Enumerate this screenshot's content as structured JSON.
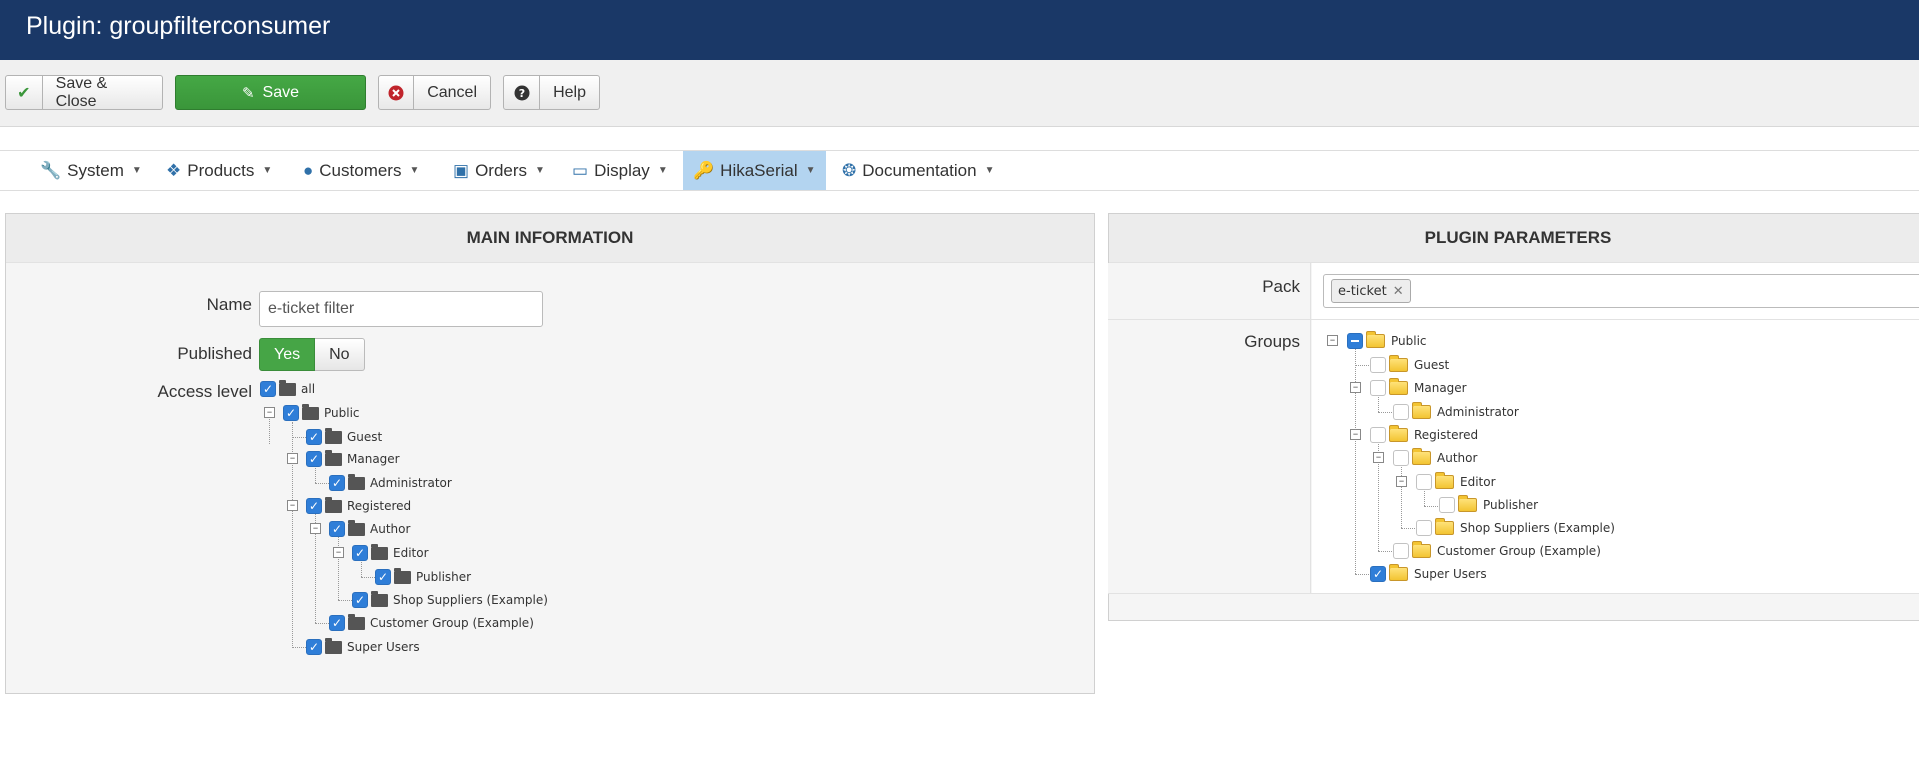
{
  "header": {
    "title": "Plugin: groupfilterconsumer"
  },
  "toolbar": {
    "save_close_label": "Save & Close",
    "save_label": "Save",
    "cancel_label": "Cancel",
    "help_label": "Help"
  },
  "nav": {
    "items": [
      {
        "label": "System",
        "icon": "wrench-icon"
      },
      {
        "label": "Products",
        "icon": "cubes-icon"
      },
      {
        "label": "Customers",
        "icon": "user-icon"
      },
      {
        "label": "Orders",
        "icon": "credit-card-icon"
      },
      {
        "label": "Display",
        "icon": "monitor-icon"
      },
      {
        "label": "HikaSerial",
        "icon": "key-icon",
        "active": true
      },
      {
        "label": "Documentation",
        "icon": "lifebuoy-icon"
      }
    ]
  },
  "main": {
    "title": "MAIN INFORMATION",
    "name_label": "Name",
    "name_value": "e-ticket filter",
    "published_label": "Published",
    "published_yes": "Yes",
    "published_no": "No",
    "access_label": "Access level",
    "access_tree": [
      {
        "label": "all",
        "checked": true
      },
      {
        "label": "Public",
        "checked": true
      },
      {
        "label": "Guest",
        "checked": true
      },
      {
        "label": "Manager",
        "checked": true
      },
      {
        "label": "Administrator",
        "checked": true
      },
      {
        "label": "Registered",
        "checked": true
      },
      {
        "label": "Author",
        "checked": true
      },
      {
        "label": "Editor",
        "checked": true
      },
      {
        "label": "Publisher",
        "checked": true
      },
      {
        "label": "Shop Suppliers (Example)",
        "checked": true
      },
      {
        "label": "Customer Group (Example)",
        "checked": true
      },
      {
        "label": "Super Users",
        "checked": true
      }
    ]
  },
  "params": {
    "title": "PLUGIN PARAMETERS",
    "pack_label": "Pack",
    "pack_tag": "e-ticket",
    "groups_label": "Groups",
    "groups_tree": [
      {
        "label": "Public",
        "state": "partial"
      },
      {
        "label": "Guest",
        "state": "unchecked"
      },
      {
        "label": "Manager",
        "state": "unchecked"
      },
      {
        "label": "Administrator",
        "state": "unchecked"
      },
      {
        "label": "Registered",
        "state": "unchecked"
      },
      {
        "label": "Author",
        "state": "unchecked"
      },
      {
        "label": "Editor",
        "state": "unchecked"
      },
      {
        "label": "Publisher",
        "state": "unchecked"
      },
      {
        "label": "Shop Suppliers (Example)",
        "state": "unchecked"
      },
      {
        "label": "Customer Group (Example)",
        "state": "unchecked"
      },
      {
        "label": "Super Users",
        "state": "checked"
      }
    ]
  },
  "colors": {
    "header_bg": "#1a3867",
    "save_green": "#46a546",
    "nav_active": "#b3d4f0",
    "checkbox_blue": "#2f7ed8"
  }
}
